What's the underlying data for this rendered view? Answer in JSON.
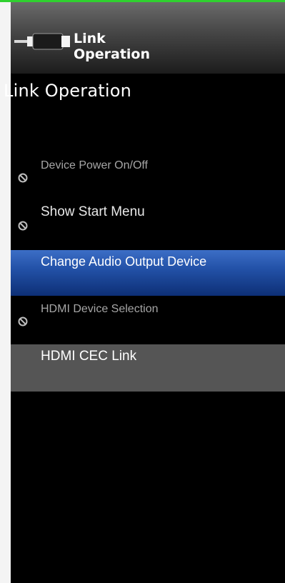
{
  "header": {
    "line1": "Link",
    "line2": "Operation",
    "icon": "hdmi-plug-icon"
  },
  "page_title": "Link Operation",
  "menu": {
    "items": [
      {
        "label": "Device Power On/Off",
        "state": "disabled",
        "icon": "no-entry-icon"
      },
      {
        "label": "Show Start Menu",
        "state": "disabled",
        "icon": "no-entry-icon"
      },
      {
        "label": "Change Audio Output Device",
        "state": "selected"
      },
      {
        "label": "HDMI Device Selection",
        "state": "disabled",
        "icon": "no-entry-icon"
      },
      {
        "label": "HDMI CEC Link",
        "state": "enabled"
      }
    ]
  },
  "colors": {
    "accent_top_line": "#2fd12f",
    "selected_item": "#2352a8",
    "menu_background": "#000000",
    "highlight_item": "#555555"
  }
}
